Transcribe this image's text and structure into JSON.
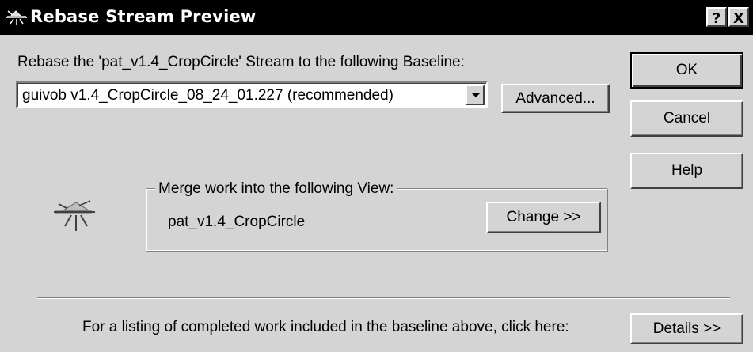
{
  "window": {
    "title": "Rebase Stream Preview",
    "help_button_label": "?",
    "close_button_label": "X"
  },
  "rebase": {
    "instruction": "Rebase the 'pat_v1.4_CropCircle' Stream to the following Baseline:",
    "baseline_selected": "guivob  v1.4_CropCircle_08_24_01.227 (recommended)",
    "advanced_label": "Advanced..."
  },
  "buttons": {
    "ok_label": "OK",
    "cancel_label": "Cancel",
    "help_label": "Help"
  },
  "merge": {
    "group_label": "Merge work into the following View:",
    "view_name": "pat_v1.4_CropCircle",
    "change_label": "Change >>",
    "icon": "view-icon"
  },
  "footer": {
    "listing_text": "For a listing of completed work included in the baseline above, click here:",
    "details_label": "Details >>"
  }
}
